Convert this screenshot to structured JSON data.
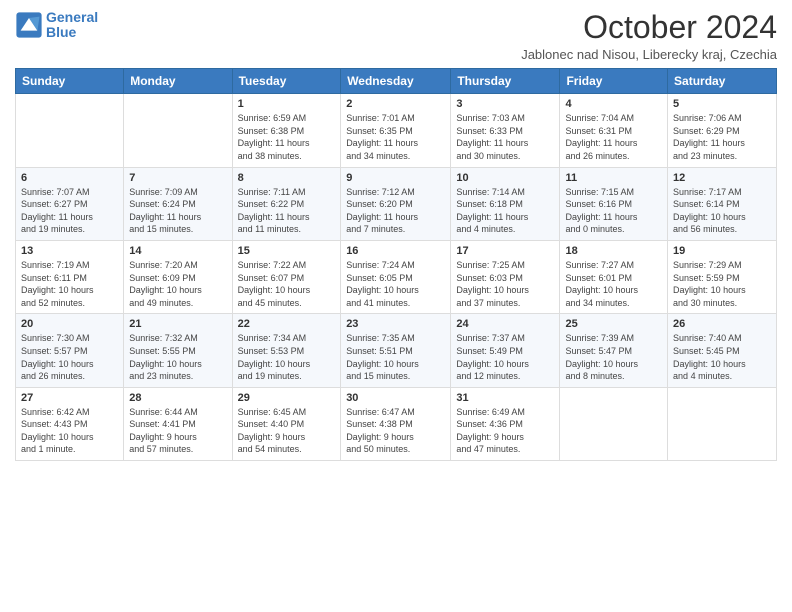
{
  "logo": {
    "line1": "General",
    "line2": "Blue"
  },
  "title": "October 2024",
  "location": "Jablonec nad Nisou, Liberecky kraj, Czechia",
  "days_header": [
    "Sunday",
    "Monday",
    "Tuesday",
    "Wednesday",
    "Thursday",
    "Friday",
    "Saturday"
  ],
  "weeks": [
    [
      {
        "day": "",
        "detail": ""
      },
      {
        "day": "",
        "detail": ""
      },
      {
        "day": "1",
        "detail": "Sunrise: 6:59 AM\nSunset: 6:38 PM\nDaylight: 11 hours\nand 38 minutes."
      },
      {
        "day": "2",
        "detail": "Sunrise: 7:01 AM\nSunset: 6:35 PM\nDaylight: 11 hours\nand 34 minutes."
      },
      {
        "day": "3",
        "detail": "Sunrise: 7:03 AM\nSunset: 6:33 PM\nDaylight: 11 hours\nand 30 minutes."
      },
      {
        "day": "4",
        "detail": "Sunrise: 7:04 AM\nSunset: 6:31 PM\nDaylight: 11 hours\nand 26 minutes."
      },
      {
        "day": "5",
        "detail": "Sunrise: 7:06 AM\nSunset: 6:29 PM\nDaylight: 11 hours\nand 23 minutes."
      }
    ],
    [
      {
        "day": "6",
        "detail": "Sunrise: 7:07 AM\nSunset: 6:27 PM\nDaylight: 11 hours\nand 19 minutes."
      },
      {
        "day": "7",
        "detail": "Sunrise: 7:09 AM\nSunset: 6:24 PM\nDaylight: 11 hours\nand 15 minutes."
      },
      {
        "day": "8",
        "detail": "Sunrise: 7:11 AM\nSunset: 6:22 PM\nDaylight: 11 hours\nand 11 minutes."
      },
      {
        "day": "9",
        "detail": "Sunrise: 7:12 AM\nSunset: 6:20 PM\nDaylight: 11 hours\nand 7 minutes."
      },
      {
        "day": "10",
        "detail": "Sunrise: 7:14 AM\nSunset: 6:18 PM\nDaylight: 11 hours\nand 4 minutes."
      },
      {
        "day": "11",
        "detail": "Sunrise: 7:15 AM\nSunset: 6:16 PM\nDaylight: 11 hours\nand 0 minutes."
      },
      {
        "day": "12",
        "detail": "Sunrise: 7:17 AM\nSunset: 6:14 PM\nDaylight: 10 hours\nand 56 minutes."
      }
    ],
    [
      {
        "day": "13",
        "detail": "Sunrise: 7:19 AM\nSunset: 6:11 PM\nDaylight: 10 hours\nand 52 minutes."
      },
      {
        "day": "14",
        "detail": "Sunrise: 7:20 AM\nSunset: 6:09 PM\nDaylight: 10 hours\nand 49 minutes."
      },
      {
        "day": "15",
        "detail": "Sunrise: 7:22 AM\nSunset: 6:07 PM\nDaylight: 10 hours\nand 45 minutes."
      },
      {
        "day": "16",
        "detail": "Sunrise: 7:24 AM\nSunset: 6:05 PM\nDaylight: 10 hours\nand 41 minutes."
      },
      {
        "day": "17",
        "detail": "Sunrise: 7:25 AM\nSunset: 6:03 PM\nDaylight: 10 hours\nand 37 minutes."
      },
      {
        "day": "18",
        "detail": "Sunrise: 7:27 AM\nSunset: 6:01 PM\nDaylight: 10 hours\nand 34 minutes."
      },
      {
        "day": "19",
        "detail": "Sunrise: 7:29 AM\nSunset: 5:59 PM\nDaylight: 10 hours\nand 30 minutes."
      }
    ],
    [
      {
        "day": "20",
        "detail": "Sunrise: 7:30 AM\nSunset: 5:57 PM\nDaylight: 10 hours\nand 26 minutes."
      },
      {
        "day": "21",
        "detail": "Sunrise: 7:32 AM\nSunset: 5:55 PM\nDaylight: 10 hours\nand 23 minutes."
      },
      {
        "day": "22",
        "detail": "Sunrise: 7:34 AM\nSunset: 5:53 PM\nDaylight: 10 hours\nand 19 minutes."
      },
      {
        "day": "23",
        "detail": "Sunrise: 7:35 AM\nSunset: 5:51 PM\nDaylight: 10 hours\nand 15 minutes."
      },
      {
        "day": "24",
        "detail": "Sunrise: 7:37 AM\nSunset: 5:49 PM\nDaylight: 10 hours\nand 12 minutes."
      },
      {
        "day": "25",
        "detail": "Sunrise: 7:39 AM\nSunset: 5:47 PM\nDaylight: 10 hours\nand 8 minutes."
      },
      {
        "day": "26",
        "detail": "Sunrise: 7:40 AM\nSunset: 5:45 PM\nDaylight: 10 hours\nand 4 minutes."
      }
    ],
    [
      {
        "day": "27",
        "detail": "Sunrise: 6:42 AM\nSunset: 4:43 PM\nDaylight: 10 hours\nand 1 minute."
      },
      {
        "day": "28",
        "detail": "Sunrise: 6:44 AM\nSunset: 4:41 PM\nDaylight: 9 hours\nand 57 minutes."
      },
      {
        "day": "29",
        "detail": "Sunrise: 6:45 AM\nSunset: 4:40 PM\nDaylight: 9 hours\nand 54 minutes."
      },
      {
        "day": "30",
        "detail": "Sunrise: 6:47 AM\nSunset: 4:38 PM\nDaylight: 9 hours\nand 50 minutes."
      },
      {
        "day": "31",
        "detail": "Sunrise: 6:49 AM\nSunset: 4:36 PM\nDaylight: 9 hours\nand 47 minutes."
      },
      {
        "day": "",
        "detail": ""
      },
      {
        "day": "",
        "detail": ""
      }
    ]
  ]
}
